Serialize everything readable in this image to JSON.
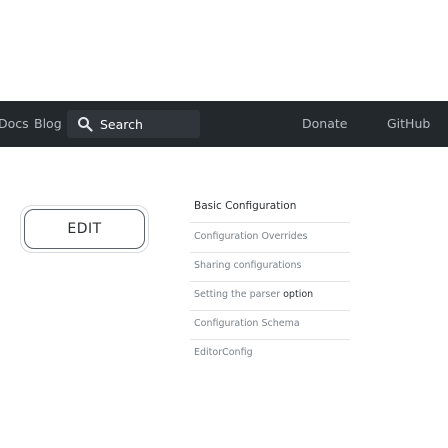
{
  "nav": {
    "items": [
      {
        "label": "Docs"
      },
      {
        "label": "Blog"
      }
    ],
    "search": {
      "placeholder": "Search",
      "icon": "search-icon"
    },
    "right_items": [
      {
        "label": "Donate"
      },
      {
        "label": "GitHub"
      }
    ],
    "background": "#23282d"
  },
  "sidebar": {
    "edit_label": "EDIT"
  },
  "toc": {
    "title": "Basic Configuration",
    "items": [
      {
        "label": "Configuration Overrides"
      },
      {
        "label": "Sharing configurations"
      },
      {
        "label_prefix": "Setting the parser ",
        "label_strong": "option"
      },
      {
        "label": "Configuration Schema"
      },
      {
        "label": "EditorConfig"
      }
    ]
  }
}
